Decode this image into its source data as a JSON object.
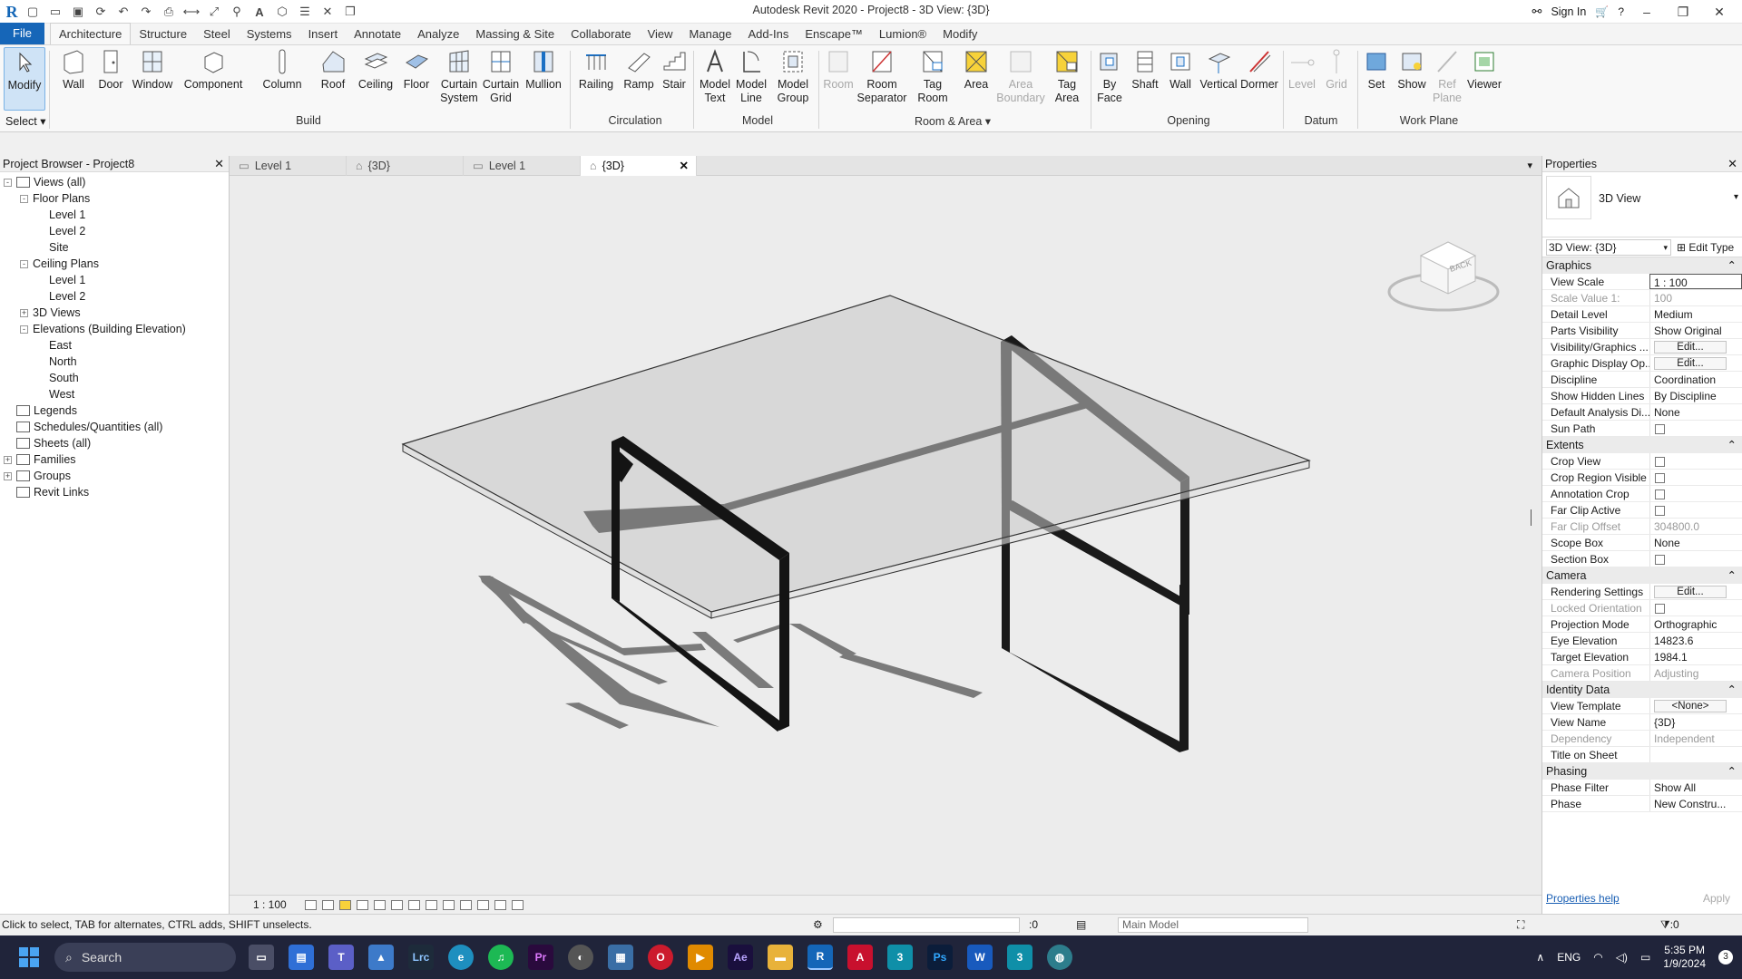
{
  "window": {
    "title": "Autodesk Revit 2020 - Project8 - 3D View: {3D}",
    "sign_in": "Sign In"
  },
  "menu": {
    "tabs": [
      "File",
      "Architecture",
      "Structure",
      "Steel",
      "Systems",
      "Insert",
      "Annotate",
      "Analyze",
      "Massing & Site",
      "Collaborate",
      "View",
      "Manage",
      "Add-Ins",
      "Enscape™",
      "Lumion®",
      "Modify"
    ]
  },
  "ribbon": {
    "select": "Select",
    "buttons": {
      "modify": "Modify",
      "wall": "Wall",
      "door": "Door",
      "window": "Window",
      "component": "Component",
      "column": "Column",
      "roof": "Roof",
      "ceiling": "Ceiling",
      "floor": "Floor",
      "curtain_system": "Curtain\nSystem",
      "curtain_grid": "Curtain\nGrid",
      "mullion": "Mullion",
      "railing": "Railing",
      "ramp": "Ramp",
      "stair": "Stair",
      "model_text": "Model\nText",
      "model_line": "Model\nLine",
      "model_group": "Model\nGroup",
      "room": "Room",
      "room_separator": "Room\nSeparator",
      "tag_room": "Tag\nRoom",
      "area": "Area",
      "area_boundary": "Area\nBoundary",
      "tag_area": "Tag\nArea",
      "by_face": "By\nFace",
      "shaft": "Shaft",
      "wall_open": "Wall",
      "vertical": "Vertical",
      "dormer": "Dormer",
      "level": "Level",
      "grid": "Grid",
      "set": "Set",
      "show": "Show",
      "ref_plane": "Ref\nPlane",
      "viewer": "Viewer"
    },
    "panels": {
      "build": "Build",
      "circulation": "Circulation",
      "model": "Model",
      "room_area": "Room & Area",
      "opening": "Opening",
      "datum": "Datum",
      "work_plane": "Work Plane"
    }
  },
  "browser": {
    "title": "Project Browser - Project8",
    "items": [
      {
        "label": "Views (all)",
        "level": 0,
        "tog": "-"
      },
      {
        "label": "Floor Plans",
        "level": 1,
        "tog": "-"
      },
      {
        "label": "Level 1",
        "level": 2
      },
      {
        "label": "Level 2",
        "level": 2
      },
      {
        "label": "Site",
        "level": 2
      },
      {
        "label": "Ceiling Plans",
        "level": 1,
        "tog": "-"
      },
      {
        "label": "Level 1",
        "level": 2
      },
      {
        "label": "Level 2",
        "level": 2
      },
      {
        "label": "3D Views",
        "level": 1,
        "tog": "+"
      },
      {
        "label": "Elevations (Building Elevation)",
        "level": 1,
        "tog": "-"
      },
      {
        "label": "East",
        "level": 2
      },
      {
        "label": "North",
        "level": 2
      },
      {
        "label": "South",
        "level": 2
      },
      {
        "label": "West",
        "level": 2
      },
      {
        "label": "Legends",
        "level": 0
      },
      {
        "label": "Schedules/Quantities (all)",
        "level": 0
      },
      {
        "label": "Sheets (all)",
        "level": 0
      },
      {
        "label": "Families",
        "level": 0,
        "tog": "+"
      },
      {
        "label": "Groups",
        "level": 0,
        "tog": "+"
      },
      {
        "label": "Revit Links",
        "level": 0
      }
    ]
  },
  "view_tabs": [
    "Level 1",
    "{3D}",
    "Level 1",
    "{3D}"
  ],
  "viewcube": {
    "face": "BACK"
  },
  "view_bar": {
    "scale": "1 : 100"
  },
  "properties": {
    "title": "Properties",
    "type_name": "3D View",
    "selector": "3D View: {3D}",
    "edit_type": "Edit Type",
    "sections": [
      {
        "name": "Graphics",
        "rows": [
          {
            "k": "View Scale",
            "v": "1 : 100",
            "kind": "input"
          },
          {
            "k": "Scale Value    1:",
            "v": "100",
            "gray": true
          },
          {
            "k": "Detail Level",
            "v": "Medium"
          },
          {
            "k": "Parts Visibility",
            "v": "Show Original"
          },
          {
            "k": "Visibility/Graphics ...",
            "v": "Edit...",
            "kind": "btn"
          },
          {
            "k": "Graphic Display Op...",
            "v": "Edit...",
            "kind": "btn"
          },
          {
            "k": "Discipline",
            "v": "Coordination"
          },
          {
            "k": "Show Hidden Lines",
            "v": "By Discipline"
          },
          {
            "k": "Default Analysis Di...",
            "v": "None"
          },
          {
            "k": "Sun Path",
            "v": "",
            "kind": "chk"
          }
        ]
      },
      {
        "name": "Extents",
        "rows": [
          {
            "k": "Crop View",
            "v": "",
            "kind": "chk"
          },
          {
            "k": "Crop Region Visible",
            "v": "",
            "kind": "chk"
          },
          {
            "k": "Annotation Crop",
            "v": "",
            "kind": "chk"
          },
          {
            "k": "Far Clip Active",
            "v": "",
            "kind": "chk"
          },
          {
            "k": "Far Clip Offset",
            "v": "304800.0",
            "gray": true
          },
          {
            "k": "Scope Box",
            "v": "None"
          },
          {
            "k": "Section Box",
            "v": "",
            "kind": "chk"
          }
        ]
      },
      {
        "name": "Camera",
        "rows": [
          {
            "k": "Rendering Settings",
            "v": "Edit...",
            "kind": "btn"
          },
          {
            "k": "Locked Orientation",
            "v": "",
            "kind": "chk",
            "gray": true
          },
          {
            "k": "Projection Mode",
            "v": "Orthographic"
          },
          {
            "k": "Eye Elevation",
            "v": "14823.6"
          },
          {
            "k": "Target Elevation",
            "v": "1984.1"
          },
          {
            "k": "Camera Position",
            "v": "Adjusting",
            "gray": true
          }
        ]
      },
      {
        "name": "Identity Data",
        "rows": [
          {
            "k": "View Template",
            "v": "<None>",
            "kind": "btn"
          },
          {
            "k": "View Name",
            "v": "{3D}"
          },
          {
            "k": "Dependency",
            "v": "Independent",
            "gray": true
          },
          {
            "k": "Title on Sheet",
            "v": ""
          }
        ]
      },
      {
        "name": "Phasing",
        "rows": [
          {
            "k": "Phase Filter",
            "v": "Show All"
          },
          {
            "k": "Phase",
            "v": "New Constru..."
          }
        ]
      }
    ],
    "help": "Properties help",
    "apply": "Apply"
  },
  "status": {
    "hint": "Click to select, TAB for alternates, CTRL adds, SHIFT unselects.",
    "count": ":0",
    "model": "Main Model",
    "filter": ":0"
  },
  "taskbar": {
    "search": "Search",
    "lang": "ENG",
    "time": "5:35 PM",
    "date": "1/9/2024",
    "badge": "3"
  }
}
